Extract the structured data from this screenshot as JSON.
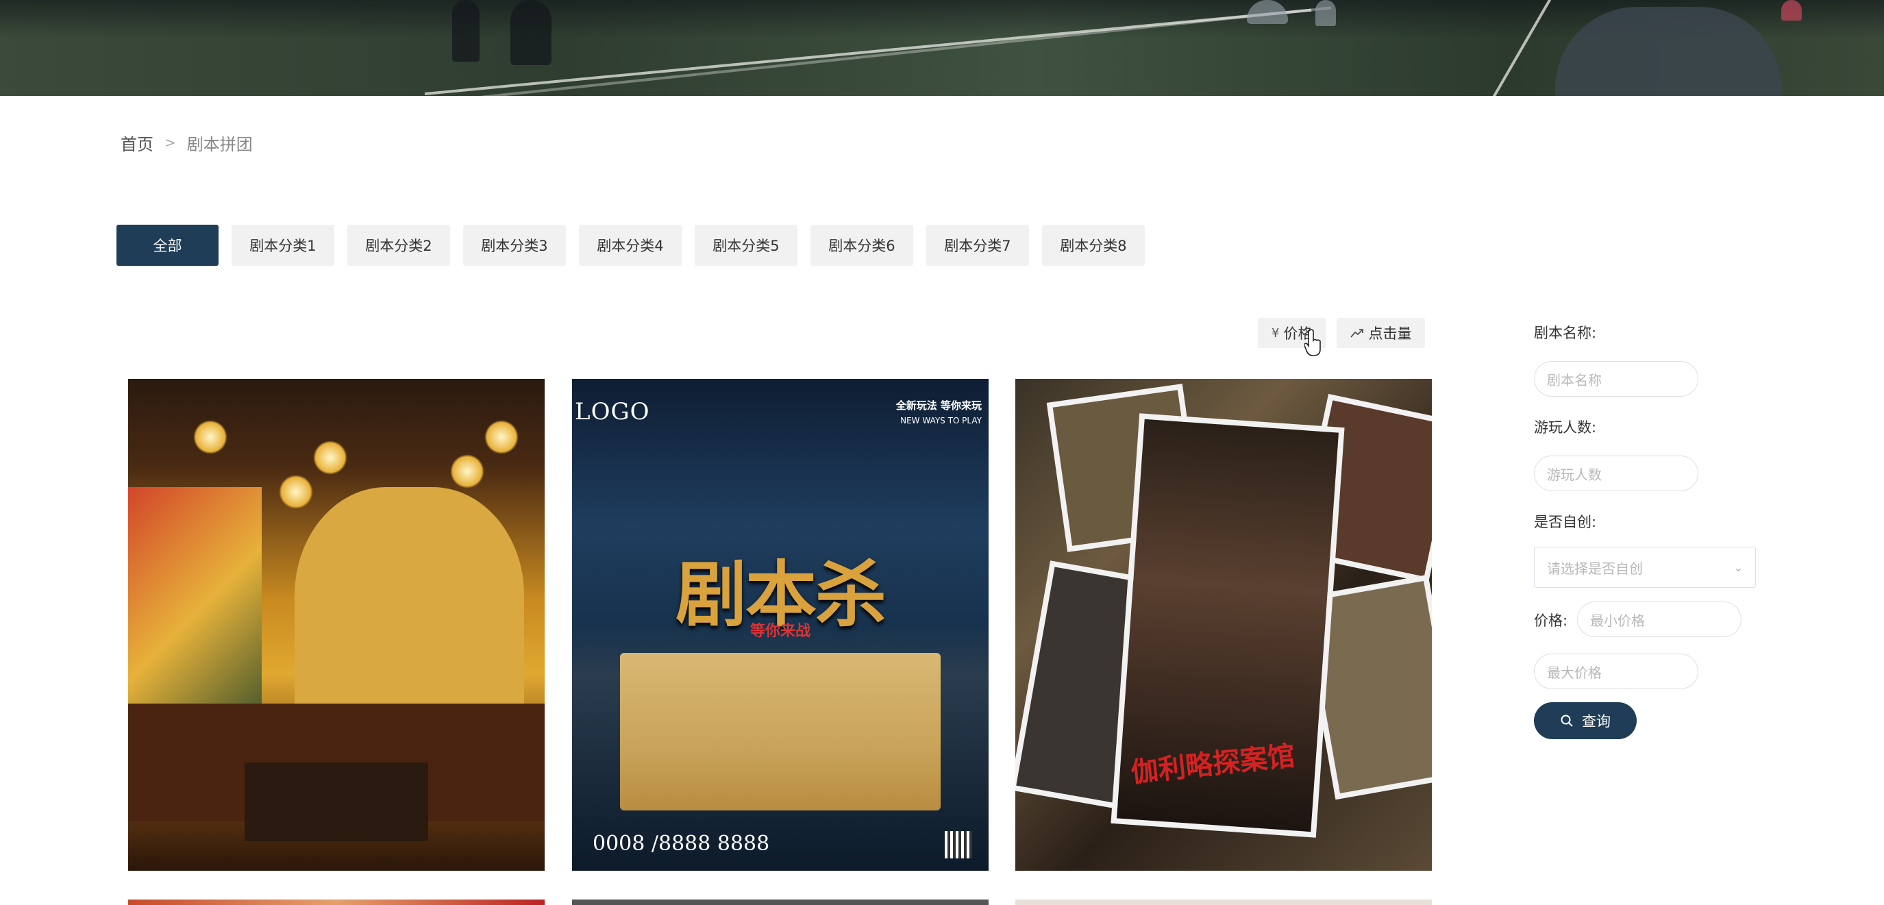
{
  "breadcrumb": {
    "home": "首页",
    "separator": ">",
    "current": "剧本拼团"
  },
  "tabs": [
    "全部",
    "剧本分类1",
    "剧本分类2",
    "剧本分类3",
    "剧本分类4",
    "剧本分类5",
    "剧本分类6",
    "剧本分类7",
    "剧本分类8"
  ],
  "sort": {
    "price": "价格",
    "price_icon": "¥",
    "clicks": "点击量"
  },
  "cards": {
    "poster": {
      "logo": "LOGO",
      "tagline": "全新玩法 等你来玩",
      "tagline_en": "NEW WAYS TO PLAY",
      "title": "剧本杀",
      "subtitle": "等你来战",
      "phone": "0008 /8888 8888"
    },
    "collage_sign": "伽利略探案馆"
  },
  "filters": {
    "name_label": "剧本名称:",
    "name_placeholder": "剧本名称",
    "players_label": "游玩人数:",
    "players_placeholder": "游玩人数",
    "original_label": "是否自创:",
    "original_placeholder": "请选择是否自创",
    "price_label": "价格:",
    "min_price_placeholder": "最小价格",
    "max_price_placeholder": "最大价格",
    "query_button": "查询"
  },
  "colors": {
    "primary": "#1f3d57",
    "tab_bg": "#f1f1f1"
  }
}
